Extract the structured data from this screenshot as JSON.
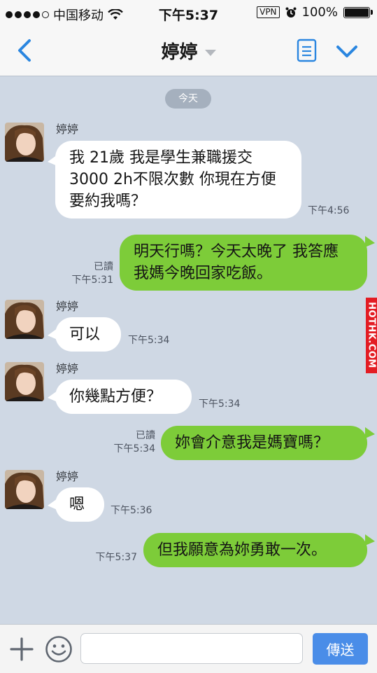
{
  "status_bar": {
    "carrier": "中国移动",
    "time": "下午5:37",
    "vpn": "VPN",
    "battery": "100%"
  },
  "nav": {
    "title": "婷婷"
  },
  "date_separator": "今天",
  "messages": [
    {
      "direction": "in",
      "sender": "婷婷",
      "text": "我 21歲 我是學生兼職援交 3000  2h不限次數 你現在方便要約我嗎？",
      "time": "下午4:56",
      "read": ""
    },
    {
      "direction": "out",
      "sender": "",
      "text": "明天行嗎？今天太晚了 我答應我媽今晚回家吃飯。",
      "time": "下午5:31",
      "read": "已讀"
    },
    {
      "direction": "in",
      "sender": "婷婷",
      "text": "可以",
      "time": "下午5:34",
      "read": ""
    },
    {
      "direction": "in",
      "sender": "婷婷",
      "text": "你幾點方便？",
      "time": "下午5:34",
      "read": ""
    },
    {
      "direction": "out",
      "sender": "",
      "text": "妳會介意我是媽寶嗎？",
      "time": "下午5:34",
      "read": "已讀"
    },
    {
      "direction": "in",
      "sender": "婷婷",
      "text": "嗯",
      "time": "下午5:36",
      "read": ""
    },
    {
      "direction": "out",
      "sender": "",
      "text": "但我願意為妳勇敢一次。",
      "time": "下午5:37",
      "read": ""
    }
  ],
  "watermark": "HOTHK.COM",
  "input_bar": {
    "placeholder": "",
    "send_label": "傳送"
  },
  "icons": {
    "back": "chevron-left-icon",
    "note": "note-icon",
    "expand": "chevron-down-icon",
    "add": "plus-icon",
    "sticker": "smile-icon"
  },
  "colors": {
    "accent": "#2a86e0",
    "outgoing_bubble": "#7dcc39",
    "incoming_bubble": "#ffffff",
    "chat_background": "#cfd8e4",
    "send_button": "#4a8de8",
    "watermark": "#e31c23"
  }
}
